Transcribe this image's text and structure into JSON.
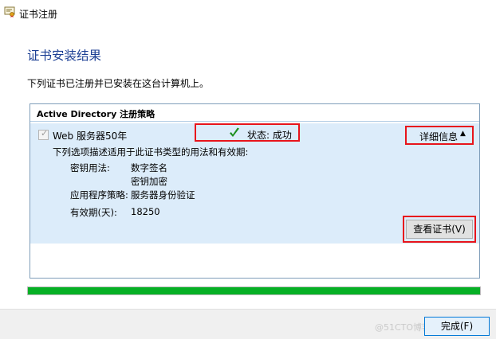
{
  "window": {
    "title": "证书注册",
    "icon": "certificate-icon"
  },
  "page": {
    "heading": "证书安装结果",
    "intro": "下列证书已注册并已安装在这台计算机上。"
  },
  "policy": {
    "header": "Active Directory 注册策略",
    "template": {
      "name": "Web 服务器50年",
      "checked": true,
      "status_label": "状态: 成功",
      "status_icon": "green-checkmark-icon",
      "details_label": "详细信息",
      "details_icon": "chevron-up-icon",
      "description": "下列选项描述适用于此证书类型的用法和有效期:",
      "key_usage_label": "密钥用法:",
      "key_usage_values": [
        "数字签名",
        "密钥加密"
      ],
      "app_policy_label": "应用程序策略:",
      "app_policy_value": "服务器身份验证",
      "validity_label": "有效期(天):",
      "validity_value": "18250",
      "view_cert_label": "查看证书(V)"
    }
  },
  "progress": {
    "value": 1.0,
    "color": "#06b025"
  },
  "footer": {
    "finish_label": "完成(F)",
    "watermark": "@51CTO博客"
  },
  "colors": {
    "heading": "#1c3f94",
    "highlight": "#e8141b",
    "block_bg": "#dcecfa"
  }
}
